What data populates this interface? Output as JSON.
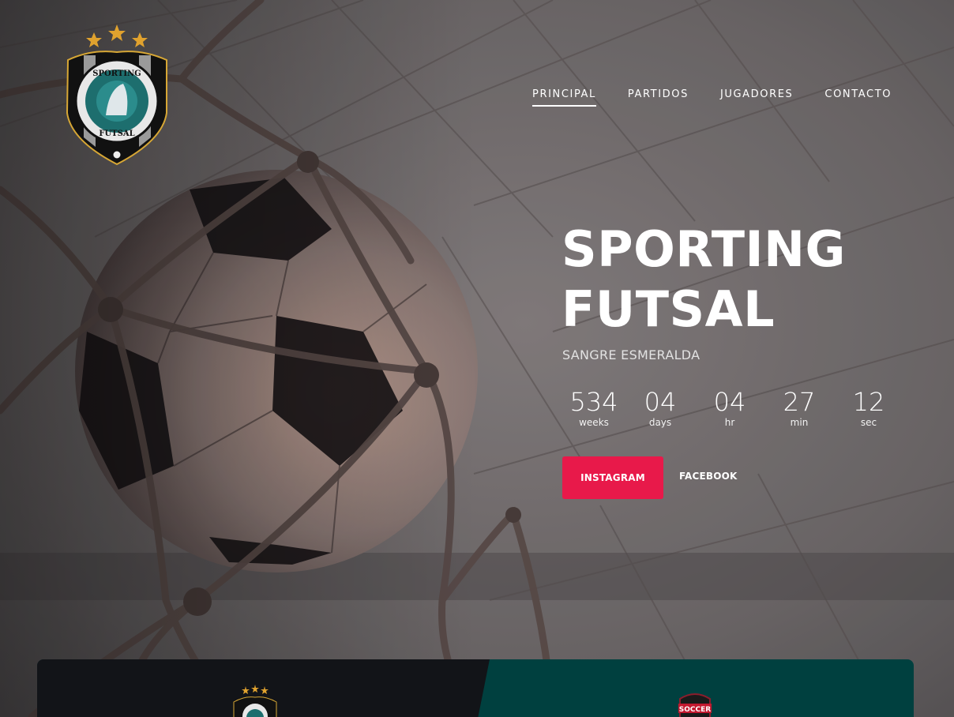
{
  "brand": {
    "logo_alt": "Sporting Futsal crest",
    "logo_text_top": "SPORTING",
    "logo_text_bottom": "FUTSAL"
  },
  "nav": {
    "items": [
      {
        "label": "PRINCIPAL",
        "active": true
      },
      {
        "label": "PARTIDOS",
        "active": false
      },
      {
        "label": "JUGADORES",
        "active": false
      },
      {
        "label": "CONTACTO",
        "active": false
      }
    ]
  },
  "hero": {
    "title_line1": "SPORTING",
    "title_line2": "FUTSAL",
    "subtitle": "SANGRE ESMERALDA"
  },
  "countdown": [
    {
      "value": "534",
      "label": "weeks"
    },
    {
      "value": "04",
      "label": "days"
    },
    {
      "value": "04",
      "label": "hr"
    },
    {
      "value": "27",
      "label": "min"
    },
    {
      "value": "12",
      "label": "sec"
    }
  ],
  "buttons": {
    "instagram": "INSTAGRAM",
    "facebook": "FACEBOOK"
  },
  "match": {
    "away_badge_text": "SOCCER"
  },
  "colors": {
    "accent": "#e8194a",
    "match_home_bg": "#121418",
    "match_away_bg": "#00403f",
    "emerald": "#1d6e6e"
  }
}
